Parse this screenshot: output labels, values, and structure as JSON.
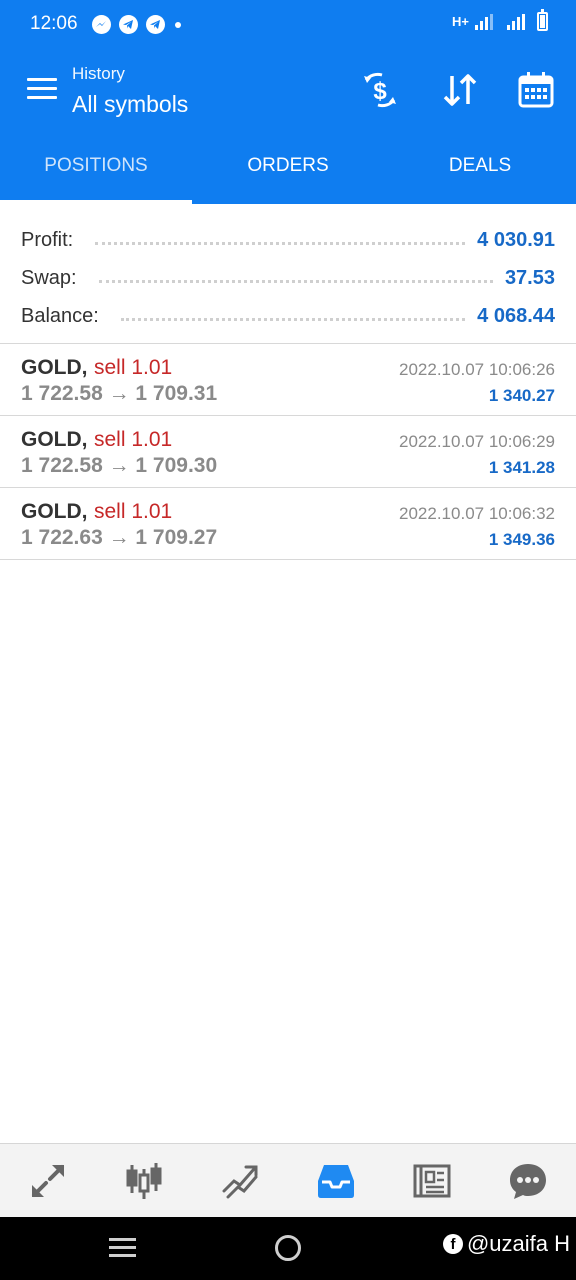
{
  "status_bar": {
    "time": "12:06",
    "network": "H+",
    "notification_icons": [
      "messenger-icon",
      "telegram-icon",
      "telegram-icon"
    ]
  },
  "app_bar": {
    "subtitle": "History",
    "title": "All symbols",
    "actions": [
      "currency-exchange-icon",
      "sort-icon",
      "calendar-icon"
    ]
  },
  "tabs": [
    {
      "label": "POSITIONS",
      "active": true
    },
    {
      "label": "ORDERS",
      "active": false
    },
    {
      "label": "DEALS",
      "active": false
    }
  ],
  "summary": {
    "profit_label": "Profit:",
    "profit_value": "4 030.91",
    "swap_label": "Swap:",
    "swap_value": "37.53",
    "balance_label": "Balance:",
    "balance_value": "4 068.44"
  },
  "deals": [
    {
      "symbol": "GOLD,",
      "type": "sell 1.01",
      "prices": "1 722.58 → 1 709.31",
      "time": "2022.10.07 10:06:26",
      "profit": "1 340.27"
    },
    {
      "symbol": "GOLD,",
      "type": "sell 1.01",
      "prices": "1 722.58 → 1 709.30",
      "time": "2022.10.07 10:06:29",
      "profit": "1 341.28"
    },
    {
      "symbol": "GOLD,",
      "type": "sell 1.01",
      "prices": "1 722.63 → 1 709.27",
      "time": "2022.10.07 10:06:32",
      "profit": "1 349.36"
    }
  ],
  "bottom_nav": {
    "items": [
      "quotes-icon",
      "chart-icon",
      "trade-icon",
      "history-icon",
      "news-icon",
      "chat-icon"
    ],
    "active": "history-icon"
  },
  "watermark": "@uzaifa H",
  "colors": {
    "primary": "#0f7df0",
    "value_blue": "#1769c7",
    "sell_red": "#c62828",
    "muted_gray": "#8a8a8a",
    "nav_bg": "#f3f3f3"
  }
}
